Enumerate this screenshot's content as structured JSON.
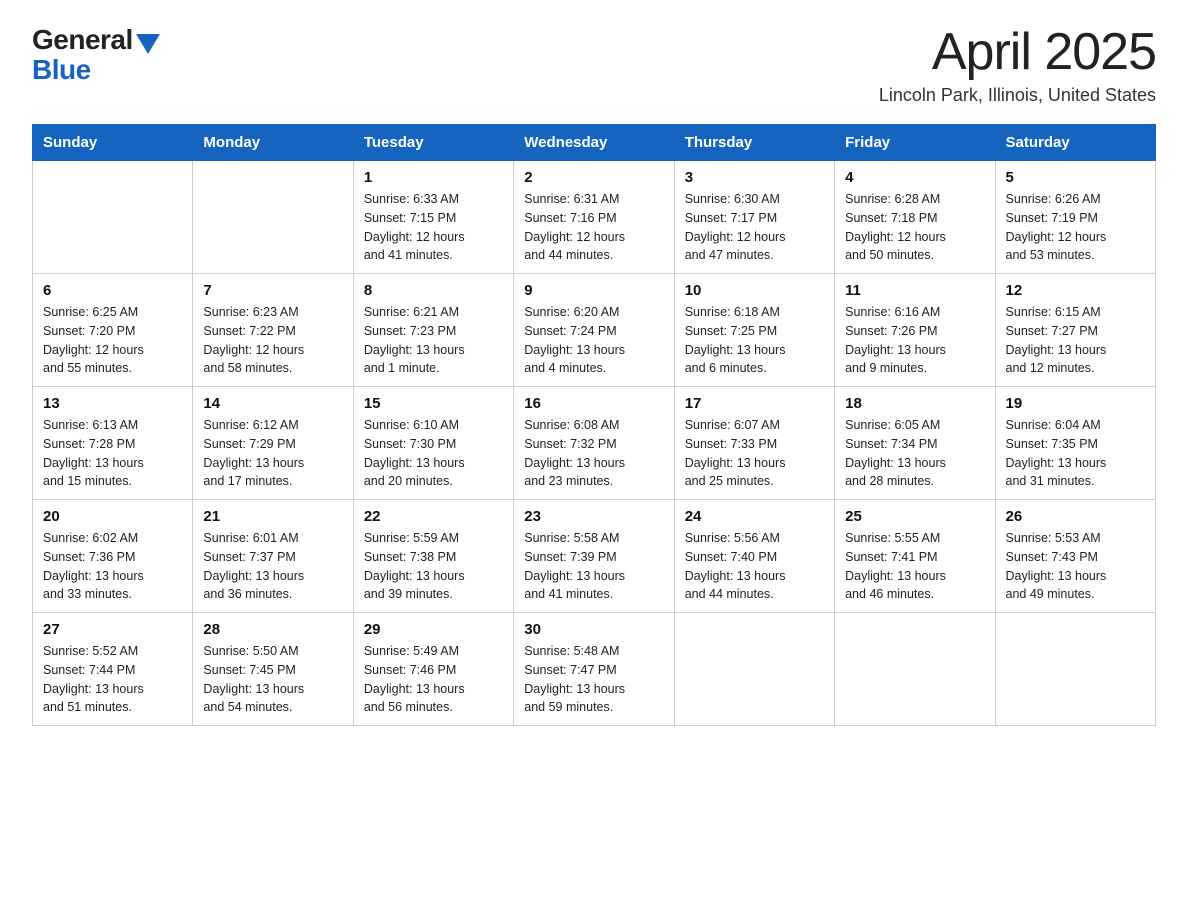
{
  "logo": {
    "general": "General",
    "blue": "Blue",
    "triangle_color": "#1565c0"
  },
  "header": {
    "title": "April 2025",
    "subtitle": "Lincoln Park, Illinois, United States"
  },
  "days_of_week": [
    "Sunday",
    "Monday",
    "Tuesday",
    "Wednesday",
    "Thursday",
    "Friday",
    "Saturday"
  ],
  "weeks": [
    [
      {
        "day": "",
        "info": ""
      },
      {
        "day": "",
        "info": ""
      },
      {
        "day": "1",
        "info": "Sunrise: 6:33 AM\nSunset: 7:15 PM\nDaylight: 12 hours\nand 41 minutes."
      },
      {
        "day": "2",
        "info": "Sunrise: 6:31 AM\nSunset: 7:16 PM\nDaylight: 12 hours\nand 44 minutes."
      },
      {
        "day": "3",
        "info": "Sunrise: 6:30 AM\nSunset: 7:17 PM\nDaylight: 12 hours\nand 47 minutes."
      },
      {
        "day": "4",
        "info": "Sunrise: 6:28 AM\nSunset: 7:18 PM\nDaylight: 12 hours\nand 50 minutes."
      },
      {
        "day": "5",
        "info": "Sunrise: 6:26 AM\nSunset: 7:19 PM\nDaylight: 12 hours\nand 53 minutes."
      }
    ],
    [
      {
        "day": "6",
        "info": "Sunrise: 6:25 AM\nSunset: 7:20 PM\nDaylight: 12 hours\nand 55 minutes."
      },
      {
        "day": "7",
        "info": "Sunrise: 6:23 AM\nSunset: 7:22 PM\nDaylight: 12 hours\nand 58 minutes."
      },
      {
        "day": "8",
        "info": "Sunrise: 6:21 AM\nSunset: 7:23 PM\nDaylight: 13 hours\nand 1 minute."
      },
      {
        "day": "9",
        "info": "Sunrise: 6:20 AM\nSunset: 7:24 PM\nDaylight: 13 hours\nand 4 minutes."
      },
      {
        "day": "10",
        "info": "Sunrise: 6:18 AM\nSunset: 7:25 PM\nDaylight: 13 hours\nand 6 minutes."
      },
      {
        "day": "11",
        "info": "Sunrise: 6:16 AM\nSunset: 7:26 PM\nDaylight: 13 hours\nand 9 minutes."
      },
      {
        "day": "12",
        "info": "Sunrise: 6:15 AM\nSunset: 7:27 PM\nDaylight: 13 hours\nand 12 minutes."
      }
    ],
    [
      {
        "day": "13",
        "info": "Sunrise: 6:13 AM\nSunset: 7:28 PM\nDaylight: 13 hours\nand 15 minutes."
      },
      {
        "day": "14",
        "info": "Sunrise: 6:12 AM\nSunset: 7:29 PM\nDaylight: 13 hours\nand 17 minutes."
      },
      {
        "day": "15",
        "info": "Sunrise: 6:10 AM\nSunset: 7:30 PM\nDaylight: 13 hours\nand 20 minutes."
      },
      {
        "day": "16",
        "info": "Sunrise: 6:08 AM\nSunset: 7:32 PM\nDaylight: 13 hours\nand 23 minutes."
      },
      {
        "day": "17",
        "info": "Sunrise: 6:07 AM\nSunset: 7:33 PM\nDaylight: 13 hours\nand 25 minutes."
      },
      {
        "day": "18",
        "info": "Sunrise: 6:05 AM\nSunset: 7:34 PM\nDaylight: 13 hours\nand 28 minutes."
      },
      {
        "day": "19",
        "info": "Sunrise: 6:04 AM\nSunset: 7:35 PM\nDaylight: 13 hours\nand 31 minutes."
      }
    ],
    [
      {
        "day": "20",
        "info": "Sunrise: 6:02 AM\nSunset: 7:36 PM\nDaylight: 13 hours\nand 33 minutes."
      },
      {
        "day": "21",
        "info": "Sunrise: 6:01 AM\nSunset: 7:37 PM\nDaylight: 13 hours\nand 36 minutes."
      },
      {
        "day": "22",
        "info": "Sunrise: 5:59 AM\nSunset: 7:38 PM\nDaylight: 13 hours\nand 39 minutes."
      },
      {
        "day": "23",
        "info": "Sunrise: 5:58 AM\nSunset: 7:39 PM\nDaylight: 13 hours\nand 41 minutes."
      },
      {
        "day": "24",
        "info": "Sunrise: 5:56 AM\nSunset: 7:40 PM\nDaylight: 13 hours\nand 44 minutes."
      },
      {
        "day": "25",
        "info": "Sunrise: 5:55 AM\nSunset: 7:41 PM\nDaylight: 13 hours\nand 46 minutes."
      },
      {
        "day": "26",
        "info": "Sunrise: 5:53 AM\nSunset: 7:43 PM\nDaylight: 13 hours\nand 49 minutes."
      }
    ],
    [
      {
        "day": "27",
        "info": "Sunrise: 5:52 AM\nSunset: 7:44 PM\nDaylight: 13 hours\nand 51 minutes."
      },
      {
        "day": "28",
        "info": "Sunrise: 5:50 AM\nSunset: 7:45 PM\nDaylight: 13 hours\nand 54 minutes."
      },
      {
        "day": "29",
        "info": "Sunrise: 5:49 AM\nSunset: 7:46 PM\nDaylight: 13 hours\nand 56 minutes."
      },
      {
        "day": "30",
        "info": "Sunrise: 5:48 AM\nSunset: 7:47 PM\nDaylight: 13 hours\nand 59 minutes."
      },
      {
        "day": "",
        "info": ""
      },
      {
        "day": "",
        "info": ""
      },
      {
        "day": "",
        "info": ""
      }
    ]
  ]
}
